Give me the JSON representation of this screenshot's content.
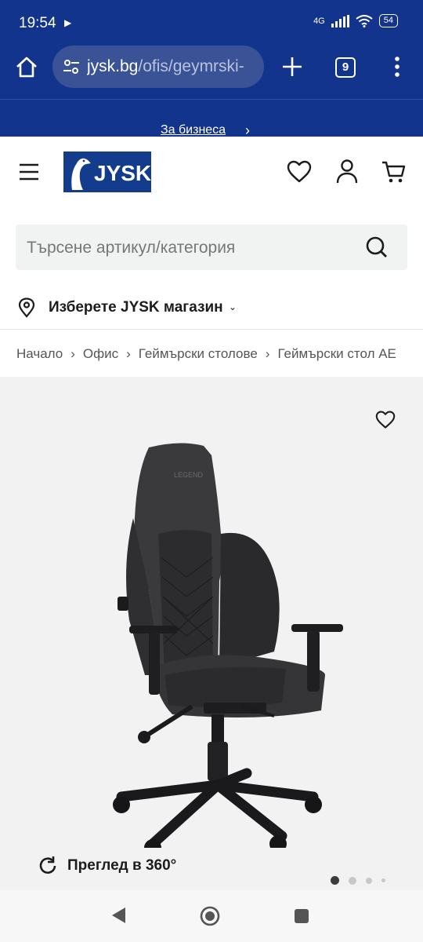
{
  "status_bar": {
    "time": "19:54",
    "network": "4G",
    "battery": "54"
  },
  "browser": {
    "url_host": "jysk.bg",
    "url_path": "/ofis/geymrski-",
    "tab_count": "9"
  },
  "business_bar": {
    "link_label": "За бизнеса"
  },
  "header": {
    "logo_text": "JYSK"
  },
  "search": {
    "placeholder": "Търсене артикул/категория"
  },
  "store_selector": {
    "label": "Изберете JYSK магазин"
  },
  "breadcrumb": {
    "items": [
      "Начало",
      "Офис",
      "Геймърски столове",
      "Геймърски стол AE"
    ]
  },
  "product_gallery": {
    "chair_brand_text": "LEGEND",
    "view_360_label": "Преглед в 360°",
    "pagination": {
      "total": 4,
      "active_index": 0
    }
  },
  "colors": {
    "brand_blue": "#13348c",
    "logo_blue": "#143c8c",
    "gallery_bg": "#f2f2f2"
  }
}
